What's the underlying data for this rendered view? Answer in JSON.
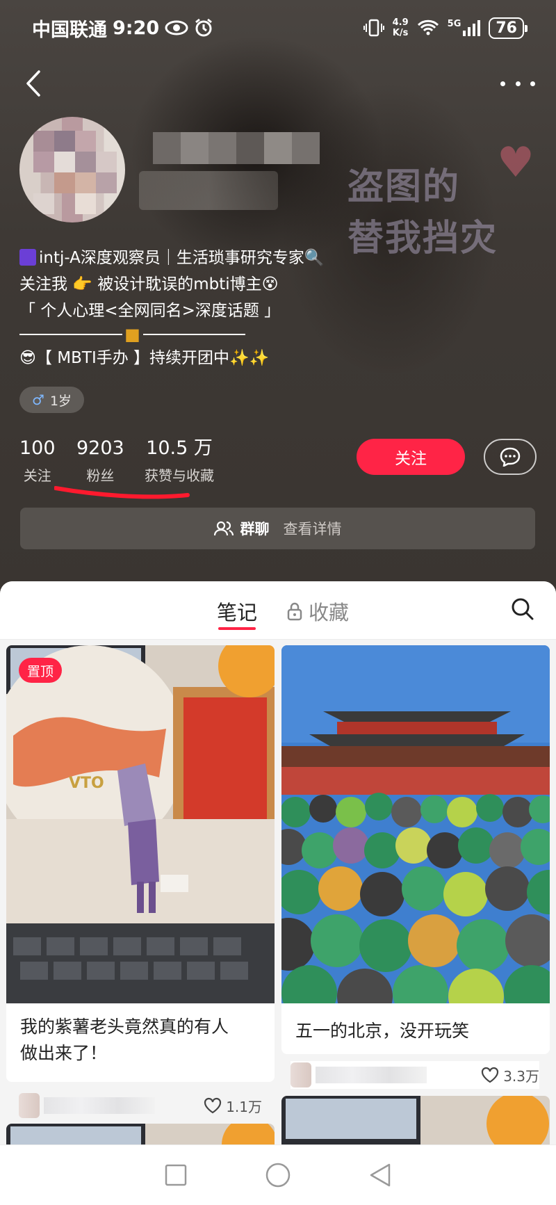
{
  "status_bar": {
    "carrier": "中国联通",
    "time": "9:20",
    "net_speed_value": "4.9",
    "net_speed_unit": "K/s",
    "network": "5G",
    "battery": "76"
  },
  "watermark": {
    "line1": "盗图的",
    "line2": "替我挡灾"
  },
  "bio": {
    "line1": "intj-A深度观察员｜生活琐事研究专家🔍",
    "line2": "关注我 👉  被设计耽误的mbti博主😵",
    "line3": "「 个人心理<全网同名>深度话题 」",
    "line4": "😎【 MBTI手办 】持续开团中✨✨"
  },
  "age_tag": "1岁",
  "stats": [
    {
      "value": "100",
      "label": "关注"
    },
    {
      "value": "9203",
      "label": "粉丝"
    },
    {
      "value": "10.5 万",
      "label": "获赞与收藏"
    }
  ],
  "follow_label": "关注",
  "group_chat": {
    "title": "群聊",
    "detail": "查看详情"
  },
  "tabs": {
    "notes": "笔记",
    "favorites": "收藏"
  },
  "cards": [
    {
      "pinned_label": "置顶",
      "title_line1": "我的紫薯老头竟然真的有人",
      "title_line2": "做出来了！",
      "likes": "1.1万"
    },
    {
      "title_line1": "五一的北京，没开玩笑",
      "likes": "3.3万"
    }
  ],
  "colors": {
    "accent": "#ff2446",
    "hero_bg": "#3a3531"
  }
}
